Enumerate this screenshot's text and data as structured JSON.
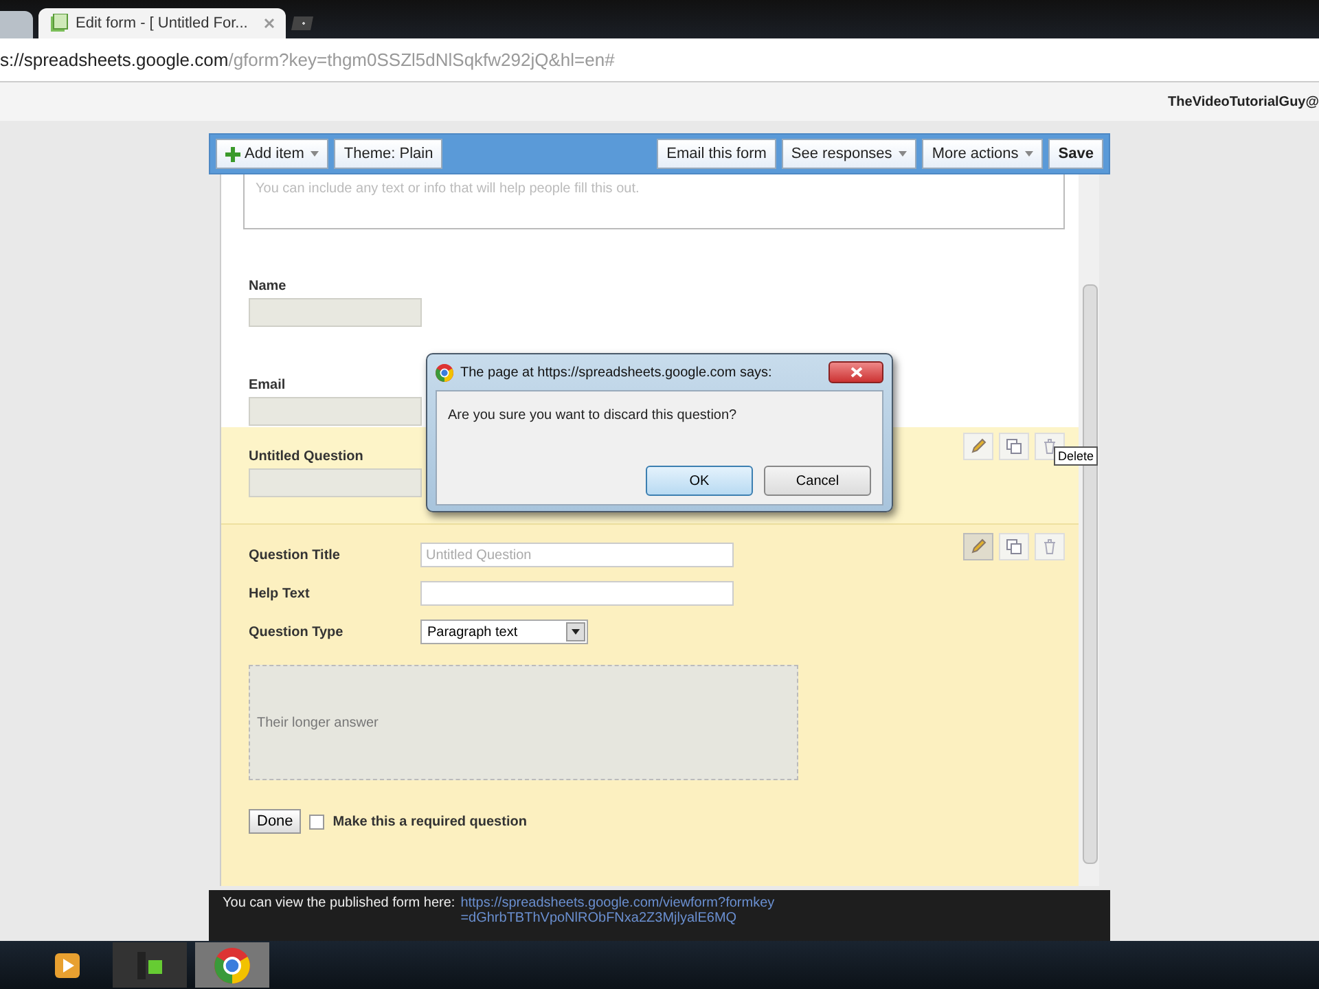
{
  "browser": {
    "tab_title": "Edit form - [ Untitled For...",
    "url_host": "s://spreadsheets.google.com",
    "url_path": "/gform?key=thgm0SSZl5dNlSqkfw292jQ&hl=en#"
  },
  "account": "TheVideoTutorialGuy@",
  "toolbar": {
    "buttons": [
      {
        "label": "Add item",
        "kind": "add"
      },
      {
        "label": "Theme: Plain",
        "kind": "plain"
      },
      {
        "label": "Email this form",
        "kind": "plain"
      },
      {
        "label": "See responses",
        "kind": "menu"
      },
      {
        "label": "More actions",
        "kind": "menu"
      },
      {
        "label": "Save",
        "kind": "bold"
      }
    ]
  },
  "form": {
    "description": "You can include any text or info that will help people fill this out.",
    "fields": [
      {
        "label": "Name"
      },
      {
        "label": "Email"
      },
      {
        "label": "Untitled Question"
      }
    ],
    "editor": {
      "title_label": "Question Title",
      "title_placeholder": "Untitled Question",
      "help_label": "Help Text",
      "type_label": "Question Type",
      "type_value": "Paragraph text",
      "answer_preview": "Their longer answer",
      "done": "Done",
      "required_label": "Make this a required question",
      "required": false
    }
  },
  "tooltip": "Delete",
  "dialog": {
    "title": "The page at https://spreadsheets.google.com says:",
    "message": "Are you sure you want to discard this question?",
    "buttons": [
      {
        "label": "OK",
        "selected": true
      },
      {
        "label": "Cancel",
        "selected": false
      }
    ]
  },
  "banner": {
    "text": "You can view the published form here:",
    "link": "https://spreadsheets.google.com/viewform?formkey=dGhrbTBThVpoNlRObFNxa2Z3MjlyalE6MQ"
  }
}
